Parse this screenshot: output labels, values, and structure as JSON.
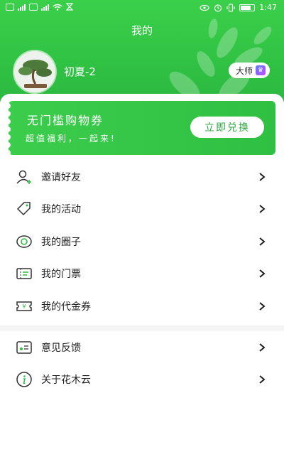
{
  "status_bar": {
    "time": "1:47"
  },
  "header": {
    "title": "我的",
    "username": "初夏-2",
    "badge_label": "大师"
  },
  "coupon": {
    "title": "无门槛购物券",
    "subtitle": "超值福利，一起来!",
    "button_label": "立即兑换"
  },
  "menu_group_1": [
    {
      "label": "邀请好友",
      "icon": "invite-friend-icon"
    },
    {
      "label": "我的活动",
      "icon": "tag-icon"
    },
    {
      "label": "我的圈子",
      "icon": "circle-icon"
    },
    {
      "label": "我的门票",
      "icon": "ticket-icon"
    },
    {
      "label": "我的代金券",
      "icon": "voucher-icon"
    }
  ],
  "menu_group_2": [
    {
      "label": "意见反馈",
      "icon": "feedback-icon"
    },
    {
      "label": "关于花木云",
      "icon": "info-icon"
    }
  ],
  "colors": {
    "brand_green": "#33c446",
    "text": "#222222"
  }
}
